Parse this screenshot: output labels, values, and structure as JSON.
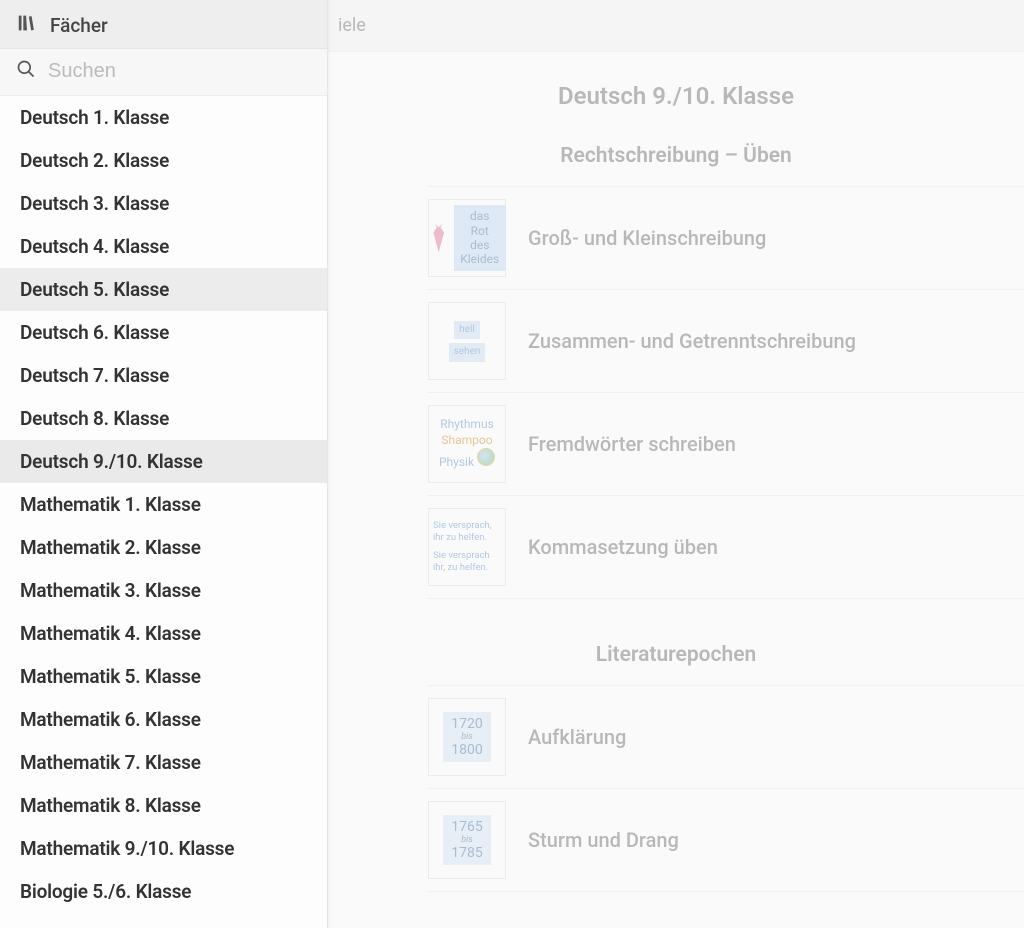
{
  "sidebar": {
    "title": "Fächer",
    "search_placeholder": "Suchen",
    "items": [
      {
        "label": "Deutsch 1. Klasse",
        "state": ""
      },
      {
        "label": "Deutsch 2. Klasse",
        "state": ""
      },
      {
        "label": "Deutsch 3. Klasse",
        "state": ""
      },
      {
        "label": "Deutsch 4. Klasse",
        "state": ""
      },
      {
        "label": "Deutsch 5. Klasse",
        "state": "hovered"
      },
      {
        "label": "Deutsch 6. Klasse",
        "state": ""
      },
      {
        "label": "Deutsch 7. Klasse",
        "state": ""
      },
      {
        "label": "Deutsch 8. Klasse",
        "state": ""
      },
      {
        "label": "Deutsch 9./10. Klasse",
        "state": "selected"
      },
      {
        "label": "Mathematik 1. Klasse",
        "state": ""
      },
      {
        "label": "Mathematik 2. Klasse",
        "state": ""
      },
      {
        "label": "Mathematik 3. Klasse",
        "state": ""
      },
      {
        "label": "Mathematik 4. Klasse",
        "state": ""
      },
      {
        "label": "Mathematik 5. Klasse",
        "state": ""
      },
      {
        "label": "Mathematik 6. Klasse",
        "state": ""
      },
      {
        "label": "Mathematik 7. Klasse",
        "state": ""
      },
      {
        "label": "Mathematik 8. Klasse",
        "state": ""
      },
      {
        "label": "Mathematik 9./10. Klasse",
        "state": ""
      },
      {
        "label": "Biologie 5./6. Klasse",
        "state": ""
      }
    ]
  },
  "header_partial": "iele",
  "main": {
    "title": "Deutsch 9./10. Klasse",
    "sections": [
      {
        "title": "Rechtschreibung – Üben",
        "items": [
          {
            "title": "Groß- und Kleinschreibung",
            "thumb": {
              "type": "dress",
              "text": "das Rot\ndes\nKleides"
            }
          },
          {
            "title": "Zusammen- und Getrenntschreibung",
            "thumb": {
              "type": "puzzle",
              "pieces": [
                "hell",
                "sehen"
              ]
            }
          },
          {
            "title": "Fremdwörter schreiben",
            "thumb": {
              "type": "wordlist",
              "words": [
                "Rhythmus",
                "Shampoo",
                "Physik"
              ]
            }
          },
          {
            "title": "Kommasetzung üben",
            "thumb": {
              "type": "sentences",
              "lines": [
                "Sie versprach, ihr zu helfen.",
                "Sie versprach ihr, zu helfen."
              ]
            }
          }
        ]
      },
      {
        "title": "Literaturepochen",
        "items": [
          {
            "title": "Aufklärung",
            "thumb": {
              "type": "daterange",
              "from": "1720",
              "to": "1800"
            }
          },
          {
            "title": "Sturm und Drang",
            "thumb": {
              "type": "daterange",
              "from": "1765",
              "to": "1785"
            }
          }
        ]
      }
    ]
  }
}
